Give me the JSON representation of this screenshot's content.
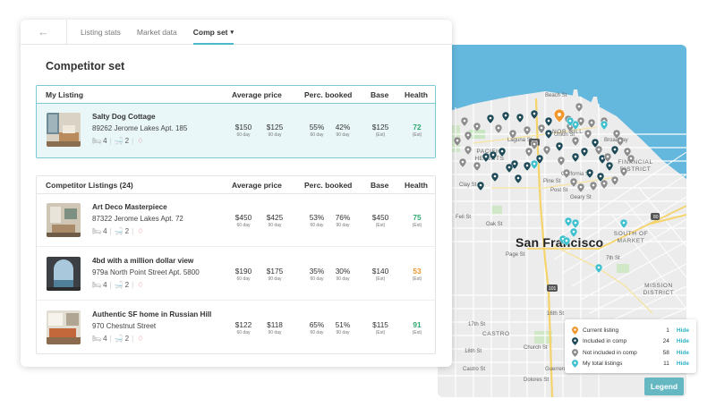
{
  "tabs": {
    "back_icon": "arrow-left-icon",
    "items": [
      {
        "label": "Listing stats"
      },
      {
        "label": "Market data"
      },
      {
        "label": "Comp set",
        "active": true
      }
    ],
    "caret": "▾"
  },
  "page_title": "Competitor set",
  "my_listing": {
    "header": {
      "section": "My Listing",
      "avg_price": "Average price",
      "perc_booked": "Perc. booked",
      "base": "Base",
      "health": "Health"
    },
    "row": {
      "name": "Salty Dog Cottage",
      "address": "89262 Jerome Lakes Apt. 185",
      "bedrooms": "4",
      "baths": "2",
      "price_60": "$150",
      "price_60_label": "60 day",
      "price_90": "$125",
      "price_90_label": "90 day",
      "booked_60": "55%",
      "booked_60_label": "60 day",
      "booked_90": "42%",
      "booked_90_label": "90 day",
      "base": "$125",
      "base_label": "(Est)",
      "health": "72",
      "health_label": "(Est)",
      "health_color": "#2eaa6e"
    }
  },
  "competitors": {
    "header": {
      "section": "Competitor Listings (24)",
      "avg_price": "Average price",
      "perc_booked": "Perc. booked",
      "base": "Base",
      "health": "Health"
    },
    "rows": [
      {
        "name": "Art Deco Masterpiece",
        "address": "87322 Jerome Lakes Apt. 72",
        "bedrooms": "4",
        "baths": "2",
        "price_60": "$450",
        "price_60_label": "60 day",
        "price_90": "$425",
        "price_90_label": "90 day",
        "booked_60": "53%",
        "booked_60_label": "60 day",
        "booked_90": "76%",
        "booked_90_label": "90 day",
        "base": "$450",
        "base_label": "(Est)",
        "health": "75",
        "health_label": "(Est)",
        "health_color": "#2eaa6e"
      },
      {
        "name": "4bd with a million dollar view",
        "address": "979a North Point Street Apt. 5800",
        "bedrooms": "4",
        "baths": "2",
        "price_60": "$190",
        "price_60_label": "60 day",
        "price_90": "$175",
        "price_90_label": "90 day",
        "booked_60": "35%",
        "booked_60_label": "60 day",
        "booked_90": "30%",
        "booked_90_label": "90 day",
        "base": "$140",
        "base_label": "(Est)",
        "health": "53",
        "health_label": "(Est)",
        "health_color": "#f0972e"
      },
      {
        "name": "Authentic SF home in Russian Hill",
        "address": "970 Chestnut Street",
        "bedrooms": "4",
        "baths": "2",
        "price_60": "$122",
        "price_60_label": "60 day",
        "price_90": "$118",
        "price_90_label": "90 day",
        "booked_60": "65%",
        "booked_60_label": "60 day",
        "booked_90": "51%",
        "booked_90_label": "90 day",
        "base": "$115",
        "base_label": "(Est)",
        "health": "91",
        "health_label": "(Est)",
        "health_color": "#2eaa6e"
      }
    ]
  },
  "map": {
    "city": "San Francisco",
    "neighborhoods": [
      "NOB HILL",
      "PACIFIC HEIGHTS",
      "FINANCIAL DISTRICT",
      "SOUTH OF MARKET",
      "MISSION DISTRICT",
      "CASTRO"
    ],
    "streets": [
      "Beach St",
      "Union St",
      "Broadway",
      "California St",
      "Pine St",
      "Geary St",
      "Post St",
      "Clay St",
      "Fell St",
      "Oak St",
      "Page St",
      "16th St",
      "17th St",
      "18th St",
      "Castro St",
      "Church St",
      "Dolores St",
      "Guerrero St",
      "7th St",
      "Laguna St"
    ],
    "highways": [
      "101",
      "101",
      "80"
    ]
  },
  "legend": {
    "items": [
      {
        "label": "Current listing",
        "count": "1",
        "action": "Hide",
        "color": "#f0972e"
      },
      {
        "label": "Included in comp",
        "count": "24",
        "action": "Hide",
        "color": "#1f4a57"
      },
      {
        "label": "Not included in comp",
        "count": "58",
        "action": "Hide",
        "color": "#8c8c8c"
      },
      {
        "label": "My total listings",
        "count": "11",
        "action": "Hide",
        "color": "#3fc0cf"
      }
    ],
    "button": "Legend"
  }
}
